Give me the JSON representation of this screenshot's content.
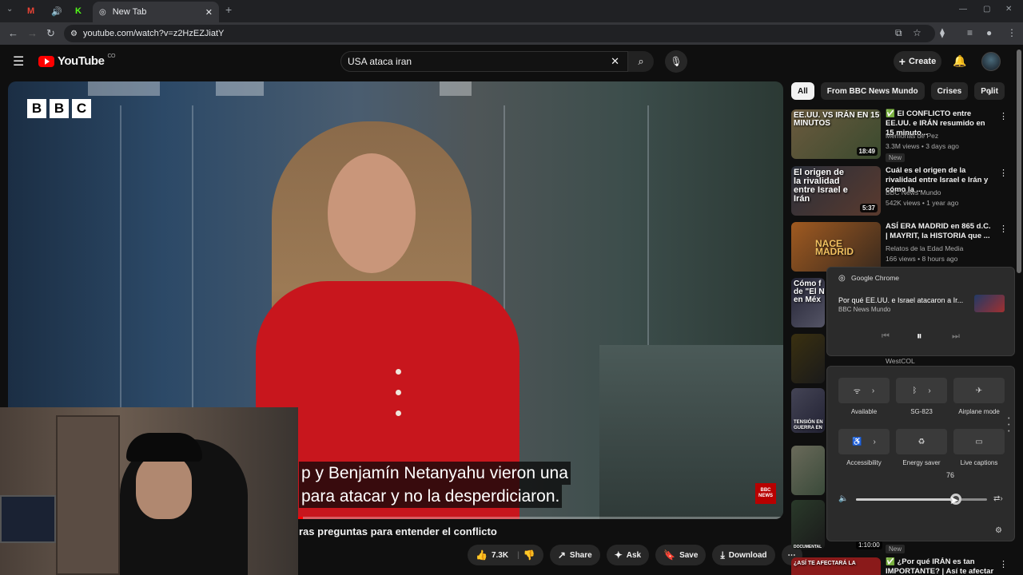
{
  "browser": {
    "tabs": [
      {
        "title": ""
      },
      {
        "title": ""
      },
      {
        "title": ""
      },
      {
        "title": "New Tab"
      }
    ],
    "url": "youtube.com/watch?v=z2HzEZJiatY"
  },
  "youtube": {
    "logo_text": "YouTube",
    "logo_suffix": "CO",
    "search_query": "USA ataca iran",
    "create_label": "Create"
  },
  "video": {
    "overlay_logo": [
      "B",
      "B",
      "C"
    ],
    "subtitle_line1": "p y Benjamín Netanyahu vieron una",
    "subtitle_line2": "para atacar y no la desperdiciaron.",
    "badge": "BBC NEWS",
    "title": "ras preguntas para entender el conflicto",
    "progress_fraction": 0.38,
    "actions": {
      "like_count": "7.3K",
      "share": "Share",
      "ask": "Ask",
      "save": "Save",
      "download": "Download"
    }
  },
  "sidebar": {
    "chips": [
      "All",
      "From BBC News Mundo",
      "Crises",
      "Polit"
    ],
    "recommendations": [
      {
        "title": "El CONFLICTO entre EE.UU. e IRÁN resumido en 15 minuto...",
        "channel": "Memorias de Pez",
        "meta": "3.3M views • 3 days ago",
        "badge": "New",
        "duration": "18:49",
        "thumb_text": "EE.UU. VS IRÁN EN 15 MINUTOS"
      },
      {
        "title": "Cuál es el origen de la rivalidad entre Israel e Irán y cómo la ...",
        "channel": "BBC News Mundo",
        "meta": "542K views • 1 year ago",
        "badge": "",
        "duration": "5:37",
        "thumb_text": "El origen de la rivalidad entre Israel e Irán"
      },
      {
        "title": "ASÍ ERA MADRID en 865 d.C. | MAYRIT, la HISTORIA que ...",
        "channel": "Relatos de la Edad Media",
        "meta": "166 views • 8 hours ago",
        "badge": "",
        "duration": "",
        "thumb_text": "NACE MADRID"
      }
    ],
    "partial_items": {
      "item4_thumb_text": "Cómo f de \"El N en Méx",
      "item5_channel": "WestCOL",
      "item6_thumb_text": "TENSIÓN EN GUERRA EN",
      "item8_thumb_text": "DOCUMENTAL",
      "item8_duration": "1:10:00",
      "item8_badge": "New",
      "item9_thumb_text": "¿ASÍ TE AFECTARÁ LA",
      "item9_title": "¿Por qué IRÁN es tan IMPORTANTE? | Así te afectar"
    }
  },
  "media_flyout": {
    "app": "Google Chrome",
    "title": "Por qué EE.UU. e Israel atacaron a Ir...",
    "subtitle": "BBC News Mundo"
  },
  "quick_settings": {
    "tiles": [
      {
        "label": "Available"
      },
      {
        "label": "SG-823"
      },
      {
        "label": "Airplane mode"
      },
      {
        "label": "Accessibility"
      },
      {
        "label": "Energy saver"
      },
      {
        "label": "Live captions"
      }
    ],
    "volume": 76
  },
  "colors": {
    "yt_red": "#ff0000",
    "bg": "#0f0f0f",
    "chrome_dark": "#202124",
    "shirt_red": "#c8161d"
  }
}
